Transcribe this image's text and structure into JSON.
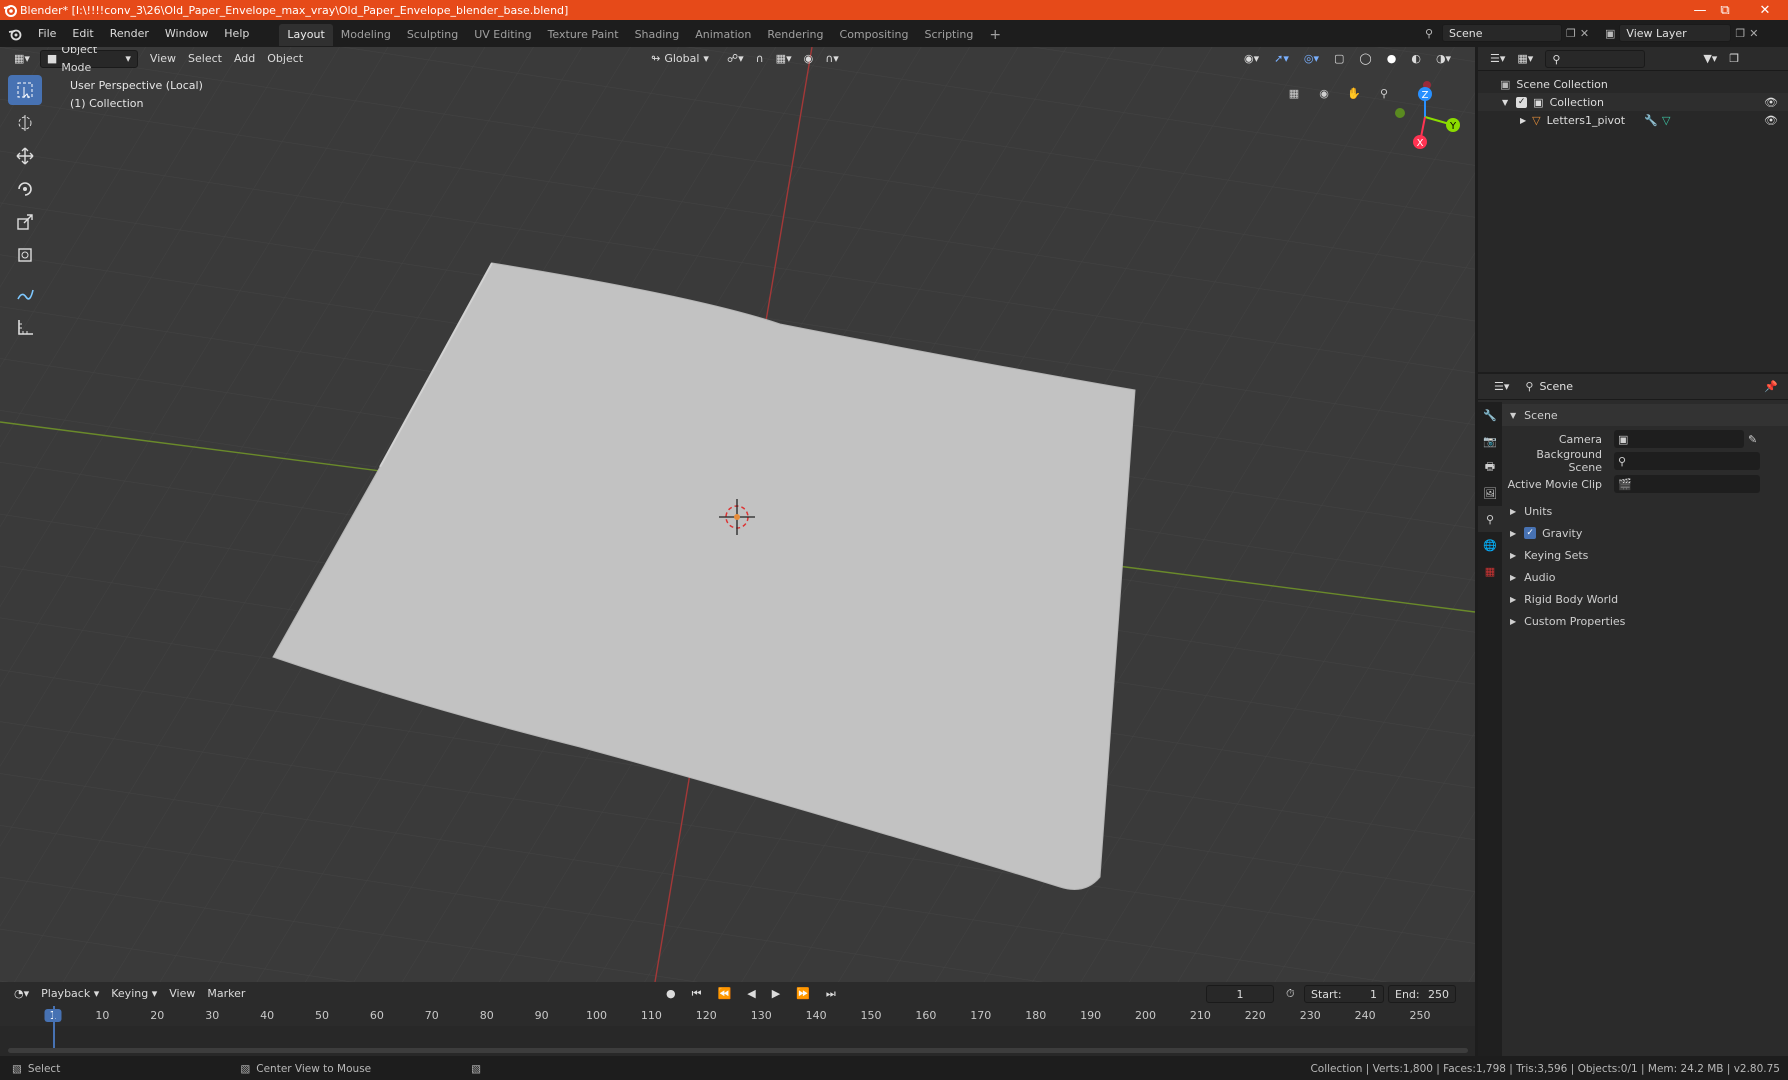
{
  "title": "Blender* [I:\\!!!!conv_3\\26\\Old_Paper_Envelope_max_vray\\Old_Paper_Envelope_blender_base.blend]",
  "menu": [
    "File",
    "Edit",
    "Render",
    "Window",
    "Help"
  ],
  "workspaces": [
    "Layout",
    "Modeling",
    "Sculpting",
    "UV Editing",
    "Texture Paint",
    "Shading",
    "Animation",
    "Rendering",
    "Compositing",
    "Scripting"
  ],
  "scene_field": "Scene",
  "view_layer_field": "View Layer",
  "viewport": {
    "mode": "Object Mode",
    "menus": [
      "View",
      "Select",
      "Add",
      "Object"
    ],
    "transform": "Global",
    "info_line1": "User Perspective (Local)",
    "info_line2": "(1) Collection",
    "gizmo": {
      "x": "X",
      "y": "Y",
      "z": "Z"
    }
  },
  "outliner": {
    "root": "Scene Collection",
    "collection": "Collection",
    "object": "Letters1_pivot"
  },
  "properties": {
    "header": "Scene",
    "panel": "Scene",
    "camera_label": "Camera",
    "bg_label": "Background Scene",
    "clip_label": "Active Movie Clip",
    "sections": [
      "Units",
      "Gravity",
      "Keying Sets",
      "Audio",
      "Rigid Body World",
      "Custom Properties"
    ],
    "gravity_checked": true
  },
  "timeline": {
    "menus": [
      "Playback",
      "Keying",
      "View",
      "Marker"
    ],
    "current_frame": "1",
    "start_label": "Start:",
    "start": "1",
    "end_label": "End:",
    "end": "250",
    "ticks": [
      "1",
      "10",
      "20",
      "30",
      "40",
      "50",
      "60",
      "70",
      "80",
      "90",
      "100",
      "110",
      "120",
      "130",
      "140",
      "150",
      "160",
      "170",
      "180",
      "190",
      "200",
      "210",
      "220",
      "230",
      "240",
      "250"
    ]
  },
  "status": {
    "select": "Select",
    "center": "Center View to Mouse",
    "stats": "Collection | Verts:1,800 | Faces:1,798 | Tris:3,596 | Objects:0/1 | Mem: 24.2 MB | v2.80.75"
  },
  "colors": {
    "titlebar": "#e64a19",
    "accent": "#4772b3",
    "x_axis": "#ff3352",
    "y_axis": "#8bdc00",
    "z_axis": "#2890ff"
  }
}
